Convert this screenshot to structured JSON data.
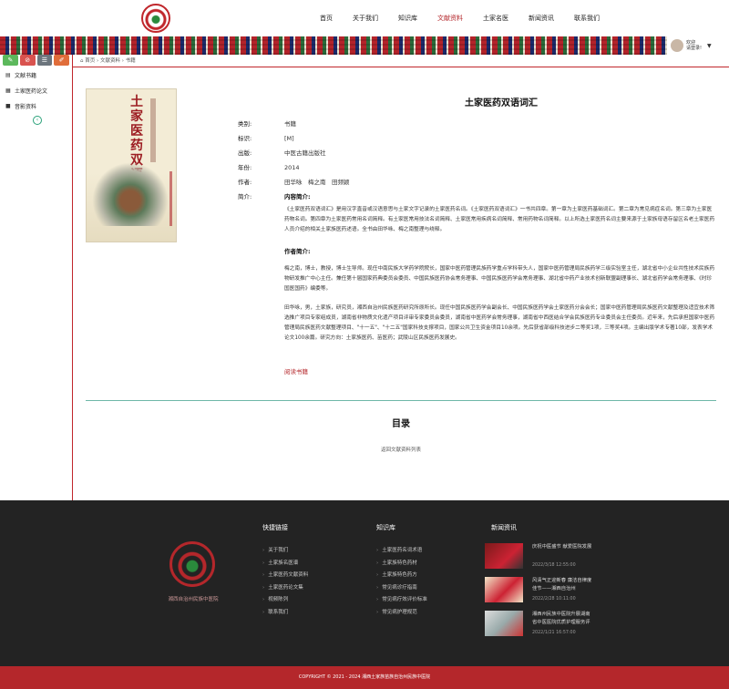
{
  "header": {
    "nav": [
      "首页",
      "关于我们",
      "知识库",
      "文献资料",
      "土家名医",
      "新闻资讯",
      "联系我们"
    ],
    "active_index": 3,
    "user": {
      "line1": "欢迎",
      "line2": "请登录!"
    }
  },
  "sidebar": {
    "tool_colors": [
      "#5cb85c",
      "#d9534f",
      "#6c757d",
      "#e06d3a"
    ],
    "items": [
      {
        "icon": "book-icon",
        "label": "文献书籍"
      },
      {
        "icon": "document-icon",
        "label": "土家医药论文"
      },
      {
        "icon": "video-icon",
        "label": "音影资料"
      }
    ]
  },
  "breadcrumb": [
    "首页",
    "文献资料",
    "书籍"
  ],
  "book": {
    "cover_title": "土家医药双语词汇",
    "title": "土家医药双语词汇",
    "fields": [
      {
        "k": "类别:",
        "v": "书籍"
      },
      {
        "k": "标识:",
        "v": "[M]"
      },
      {
        "k": "出版:",
        "v": "中医古籍出版社"
      },
      {
        "k": "年份:",
        "v": "2014"
      },
      {
        "k": "作者:",
        "v": "田华咏　梅之南　田频颖"
      },
      {
        "k": "简介:",
        "v": "内容简介:"
      }
    ],
    "intro": "《土家医药双语词汇》是用汉字直音或汉语意思与土家文字记录的土家医药名词。《土家医药双语词汇》一书共四章。第一章为土家医药基础词汇。第二章为常见病症名词。第三章为土家医药物名词。第四章为土家医药常用名词简释。有土家医常用技法名词简释、土家医常用疾病名词简释、常用药物名词简释。以上所选土家医药名词主要来源于土家族母语存留区名老土家医药人员介绍的相关土家族医药述语。全书由田华咏、梅之南整理与绕释。",
    "author_heading": "作者简介:",
    "author1": "梅之南，博士，教授，博士生导师。现任中南民族大学药学院院长，国家中医药管理民族药学重点学科带头人，国家中医药管理局民族药学三级实验室主任，湖北省中小企业共性技术民族药物研发推广中心主任。兼任第十届国家药典委员会委员、中国民族医药协会常务理事、中国民族医药学会常务理事、湖北省中药产业技术创新联盟副理事长、湖北省药学会常务理事、《时珍国医国药》编委等。",
    "author2": "田华咏，男，土家族，研究员，湘西自治州民族医药研究所原所长。现任中国民族医药学会副会长、中国民族医药学会土家医药分会会长；国家中医药管理局民族医药文献整理及适宜技术筛选推广项目专家组成员，湖南省非物质文化遗产项目评审专家委员会委员，湖南省中医药学会常务理事，湖南省中西医结合学会民族医药专业委员会主任委员。近年来，先后承担国家中医药管理局民族医药文献整理项目、\"十一五\"、\"十二五\"国家科技支撑项目，国家公共卫生资金项目10余项。先后获省部级科技进步二等奖1项，三等奖4项。主编出版学术专著10部，发表学术论文100余篇。研究方向：土家族医药、苗医药；武陵山区民族医药发展史。",
    "read_label": "阅读书籍"
  },
  "toc": {
    "title": "目录",
    "note": "返回文献资料列表"
  },
  "footer": {
    "logo_text": "湘西自治州民族中医院",
    "cols": [
      {
        "title": "快捷链接",
        "links": [
          "关于我们",
          "土家族名医谱",
          "土家医药文献资料",
          "土家医药论文集",
          "视频陈列",
          "联系我们"
        ]
      },
      {
        "title": "知识库",
        "links": [
          "土家医药名词术语",
          "土家族特色药材",
          "土家族特色药方",
          "常见病诊疗指南",
          "常见病疗效评价标准",
          "常见病护理规范"
        ]
      }
    ],
    "news_title": "新闻资讯",
    "news": [
      {
        "title": "庆祝中医盛节 献爱医院发展",
        "date": "2022/3/18 12:55:00"
      },
      {
        "title": "风清气正迎新春 廉洁自律度佳节——湘西自治州",
        "date": "2022/2/28 10:11:00"
      },
      {
        "title": "湘西州民族中医院升展湖南省中医医院优质护理服务评",
        "date": "2022/1/21 16:57:00"
      }
    ],
    "copyright": "COPYRIGHT © 2021 - 2024 湘西土家族苗族自治州民族中医院"
  }
}
